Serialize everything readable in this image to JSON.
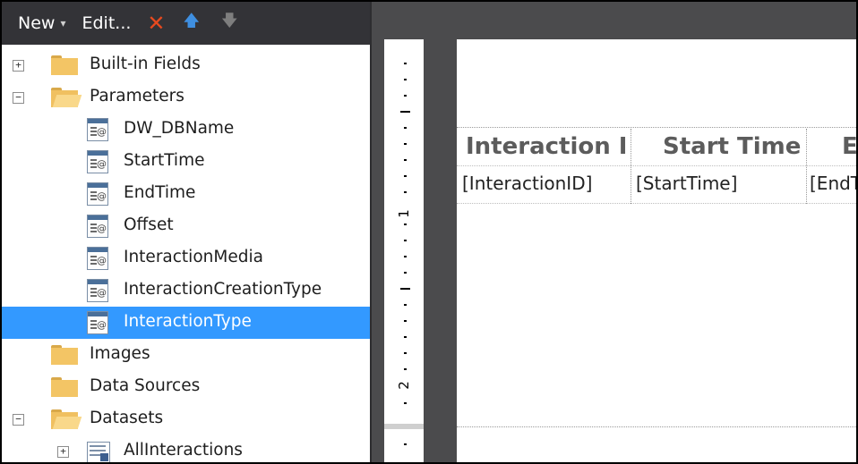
{
  "toolbar": {
    "new_label": "New",
    "caret": "▾",
    "edit_label": "Edit...",
    "delete_icon": "✕",
    "up_icon": "🡅",
    "down_icon": "🡇"
  },
  "tree": {
    "built_in_fields": "Built-in Fields",
    "parameters": "Parameters",
    "params": [
      "DW_DBName",
      "StartTime",
      "EndTime",
      "Offset",
      "InteractionMedia",
      "InteractionCreationType",
      "InteractionType"
    ],
    "images": "Images",
    "data_sources": "Data Sources",
    "datasets": "Datasets",
    "all_interactions": "AllInteractions",
    "expander_collapsed": "+",
    "expander_expanded": "−"
  },
  "ruler": {
    "label_1": "1",
    "label_2": "2"
  },
  "report": {
    "headers": [
      "Interaction I",
      "Start Time",
      "E"
    ],
    "details": [
      "[InteractionID]",
      "[StartTime]",
      "[EndT"
    ]
  },
  "colors": {
    "toolbar_bg": "#333337",
    "selection": "#3399ff",
    "designer_bg": "#4b4b4d",
    "folder": "#f3c565",
    "delete": "#e84a1f",
    "arrow_up": "#3f8fe0"
  }
}
